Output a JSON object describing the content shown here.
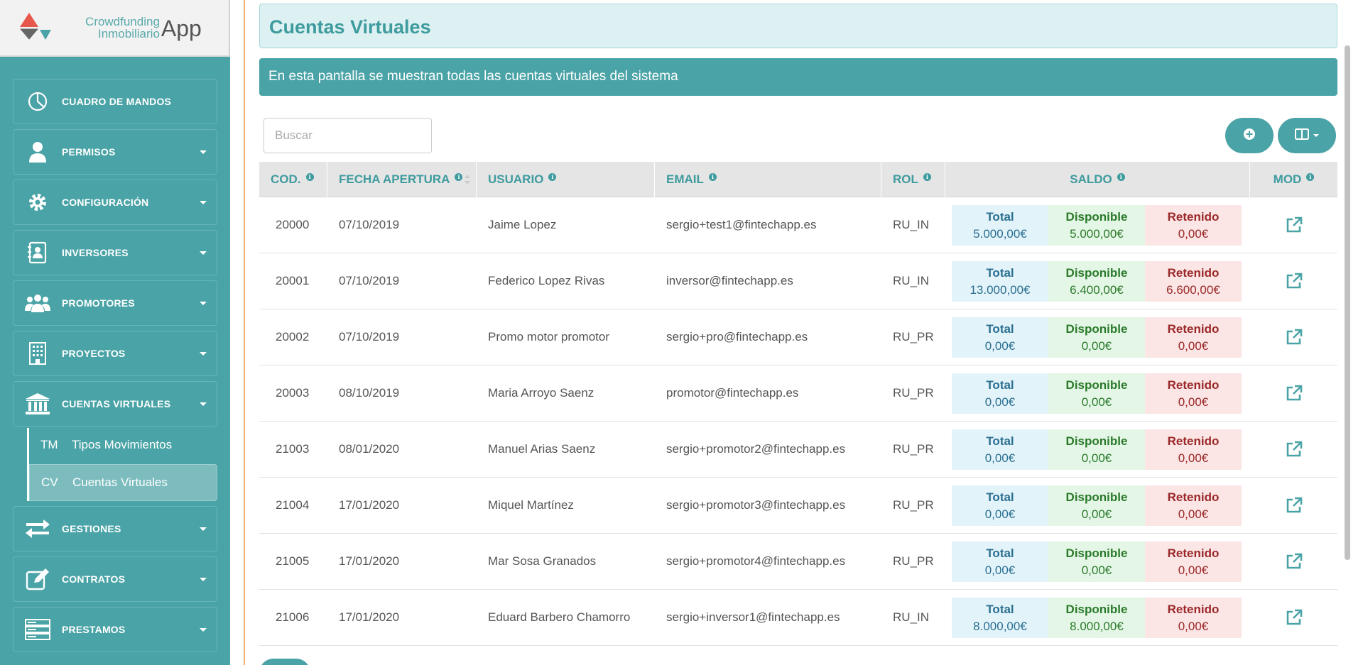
{
  "brand": {
    "line1": "Crowdfunding",
    "line2": "Inmobiliario",
    "app": "App",
    "colors": {
      "teal": "#4aa3a6",
      "red": "#e8574b",
      "gray": "#666666"
    }
  },
  "sidebar": {
    "items": [
      {
        "label": "CUADRO DE MANDOS",
        "icon": "pie-chart-icon",
        "has_caret": false
      },
      {
        "label": "PERMISOS",
        "icon": "user-icon",
        "has_caret": true
      },
      {
        "label": "CONFIGURACIÓN",
        "icon": "gear-icon",
        "has_caret": true
      },
      {
        "label": "INVERSORES",
        "icon": "contact-book-icon",
        "has_caret": true
      },
      {
        "label": "PROMOTORES",
        "icon": "users-icon",
        "has_caret": true
      },
      {
        "label": "PROYECTOS",
        "icon": "building-icon",
        "has_caret": true
      },
      {
        "label": "CUENTAS VIRTUALES",
        "icon": "bank-icon",
        "has_caret": true
      },
      {
        "label": "GESTIONES",
        "icon": "exchange-icon",
        "has_caret": true
      },
      {
        "label": "CONTRATOS",
        "icon": "edit-icon",
        "has_caret": true
      },
      {
        "label": "PRESTAMOS",
        "icon": "server-icon",
        "has_caret": true
      }
    ],
    "submenu": [
      {
        "abbr": "TM",
        "label": "Tipos Movimientos",
        "active": false
      },
      {
        "abbr": "CV",
        "label": "Cuentas Virtuales",
        "active": true
      }
    ]
  },
  "page": {
    "title": "Cuentas Virtuales",
    "description": "En esta pantalla se muestran todas las cuentas virtuales del sistema"
  },
  "search": {
    "placeholder": "Buscar"
  },
  "table": {
    "columns": [
      {
        "label": "COD.",
        "info": true
      },
      {
        "label": "FECHA APERTURA",
        "info": true,
        "sortable": true
      },
      {
        "label": "USUARIO",
        "info": true
      },
      {
        "label": "EMAIL",
        "info": true
      },
      {
        "label": "ROL",
        "info": true
      },
      {
        "label": "SALDO",
        "info": true
      },
      {
        "label": "MOD",
        "info": true
      }
    ],
    "saldo_labels": {
      "total": "Total",
      "disponible": "Disponible",
      "retenido": "Retenido"
    },
    "rows": [
      {
        "cod": "20000",
        "fecha": "07/10/2019",
        "usuario": "Jaime Lopez",
        "email": "sergio+test1@fintechapp.es",
        "rol": "RU_IN",
        "total": "5.000,00€",
        "disponible": "5.000,00€",
        "retenido": "0,00€"
      },
      {
        "cod": "20001",
        "fecha": "07/10/2019",
        "usuario": "Federico Lopez Rivas",
        "email": "inversor@fintechapp.es",
        "rol": "RU_IN",
        "total": "13.000,00€",
        "disponible": "6.400,00€",
        "retenido": "6.600,00€"
      },
      {
        "cod": "20002",
        "fecha": "07/10/2019",
        "usuario": "Promo motor promotor",
        "email": "sergio+pro@fintechapp.es",
        "rol": "RU_PR",
        "total": "0,00€",
        "disponible": "0,00€",
        "retenido": "0,00€"
      },
      {
        "cod": "20003",
        "fecha": "08/10/2019",
        "usuario": "Maria Arroyo Saenz",
        "email": "promotor@fintechapp.es",
        "rol": "RU_PR",
        "total": "0,00€",
        "disponible": "0,00€",
        "retenido": "0,00€"
      },
      {
        "cod": "21003",
        "fecha": "08/01/2020",
        "usuario": "Manuel Arias Saenz",
        "email": "sergio+promotor2@fintechapp.es",
        "rol": "RU_PR",
        "total": "0,00€",
        "disponible": "0,00€",
        "retenido": "0,00€"
      },
      {
        "cod": "21004",
        "fecha": "17/01/2020",
        "usuario": "Miquel Martínez",
        "email": "sergio+promotor3@fintechapp.es",
        "rol": "RU_PR",
        "total": "0,00€",
        "disponible": "0,00€",
        "retenido": "0,00€"
      },
      {
        "cod": "21005",
        "fecha": "17/01/2020",
        "usuario": "Mar Sosa Granados",
        "email": "sergio+promotor4@fintechapp.es",
        "rol": "RU_PR",
        "total": "0,00€",
        "disponible": "0,00€",
        "retenido": "0,00€"
      },
      {
        "cod": "21006",
        "fecha": "17/01/2020",
        "usuario": "Eduard Barbero Chamorro",
        "email": "sergio+inversor1@fintechapp.es",
        "rol": "RU_IN",
        "total": "8.000,00€",
        "disponible": "8.000,00€",
        "retenido": "0,00€"
      }
    ]
  },
  "icons": {
    "add_button": "plus-circle-icon",
    "columns_button": "columns-icon",
    "row_action": "external-link-icon"
  }
}
